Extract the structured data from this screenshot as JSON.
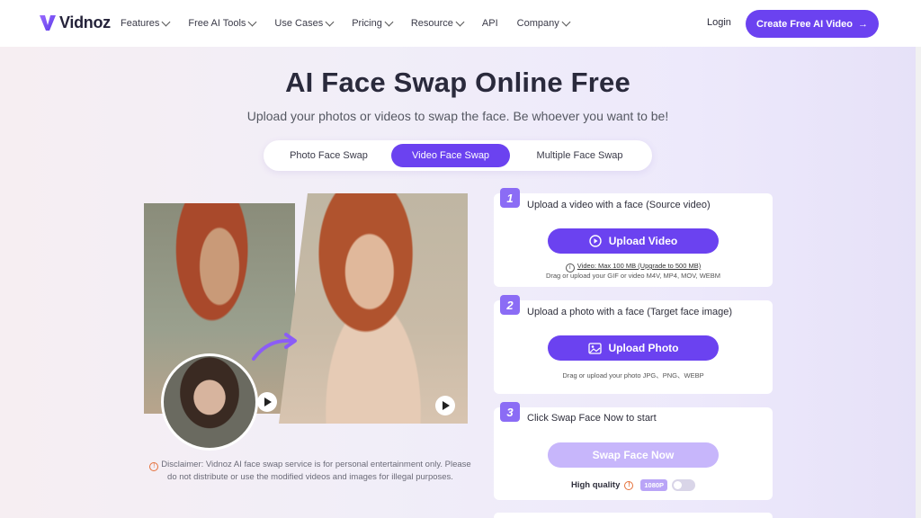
{
  "nav": {
    "logo": "Vidnoz",
    "items": [
      "Features",
      "Free AI Tools",
      "Use Cases",
      "Pricing",
      "Resource",
      "API",
      "Company"
    ],
    "login": "Login",
    "cta": "Create Free AI Video"
  },
  "hero": {
    "title": "AI Face Swap Online Free",
    "subtitle": "Upload your photos or videos to swap the face. Be whoever you want to be!"
  },
  "tabs": [
    {
      "label": "Photo Face Swap",
      "active": false
    },
    {
      "label": "Video Face Swap",
      "active": true
    },
    {
      "label": "Multiple Face Swap",
      "active": false
    }
  ],
  "disclaimer": "Disclaimer: Vidnoz AI face swap service is for personal entertainment only. Please do not distribute or use the modified videos and images for illegal purposes.",
  "steps": {
    "s1": {
      "num": "1",
      "label": "Upload a video with a face (Source video)",
      "button": "Upload Video",
      "limit": "Video: Max 100 MB (Upgrade to 500 MB)",
      "formats": "Drag or upload your GIF or video M4V, MP4, MOV, WEBM"
    },
    "s2": {
      "num": "2",
      "label": "Upload a photo with a face (Target face image)",
      "button": "Upload Photo",
      "formats": "Drag or upload your photo JPG、PNG、WEBP"
    },
    "s3": {
      "num": "3",
      "label": "Click Swap Face Now to start",
      "button": "Swap Face Now",
      "quality_label": "High quality",
      "quality_badge": "1080P",
      "toggle_on": false
    }
  },
  "colors": {
    "accent": "#6b42f0",
    "accent_disabled": "#c7b6fb",
    "step_num": "#8b6cf5"
  }
}
